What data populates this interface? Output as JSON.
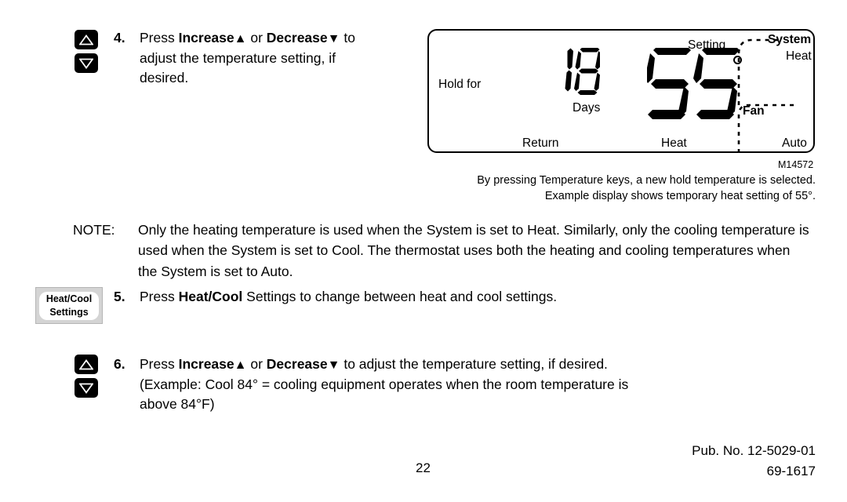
{
  "document": {
    "page_number": "22",
    "pub_number": "Pub. No. 12-5029-01",
    "doc_number": "69-1617"
  },
  "step4": {
    "number": "4.",
    "line1_a": "Press ",
    "line1_increase": "Increase",
    "line1_up_arrow": "▲",
    "line1_b": " or ",
    "line1_decrease": "Decrease",
    "line1_down_arrow": "▼",
    "line1_c": " to",
    "line2": "adjust the temperature setting, if",
    "line3": "desired.",
    "icon_up": "increase-arrow-key",
    "icon_down": "decrease-arrow-key"
  },
  "note": {
    "label": "NOTE:",
    "text": "Only the heating temperature is used when the System is set to Heat. Similarly, only the cooling temperature is used when the System is set to Cool. The thermostat uses both the heating and cooling temperatures when the System is set to Auto."
  },
  "step5": {
    "number": "5.",
    "text_a": "Press ",
    "text_bold": "Heat/Cool",
    "text_b": " Settings to change between heat and cool settings.",
    "button_line1": "Heat/Cool",
    "button_line2": "Settings"
  },
  "step6": {
    "number": "6.",
    "line1_a": "Press ",
    "line1_increase": "Increase",
    "line1_up_arrow": "▲",
    "line1_b": " or ",
    "line1_decrease": "Decrease",
    "line1_down_arrow": "▼",
    "line1_c": " to adjust the temperature setting, if desired.",
    "line2": "(Example: Cool 84° = cooling equipment  operates when the room temperature is",
    "line3": "above 84°F)"
  },
  "lcd": {
    "hold_for": "Hold for",
    "days_value": "18",
    "days_label": "Days",
    "return_label": "Return",
    "setting_label": "Setting",
    "setting_value": "55",
    "degree_symbol": "°",
    "heat_label": "Heat",
    "system_label": "System",
    "system_value": "Heat",
    "fan_label": "Fan",
    "fan_value": "Auto"
  },
  "caption": {
    "figure_id": "M14572",
    "line1": "By pressing Temperature keys, a new hold temperature is selected.",
    "line2": "Example display shows temporary heat setting of 55°."
  },
  "colors": {
    "ink": "#000000",
    "page": "#ffffff",
    "button_frame": "#d4d4d4"
  }
}
